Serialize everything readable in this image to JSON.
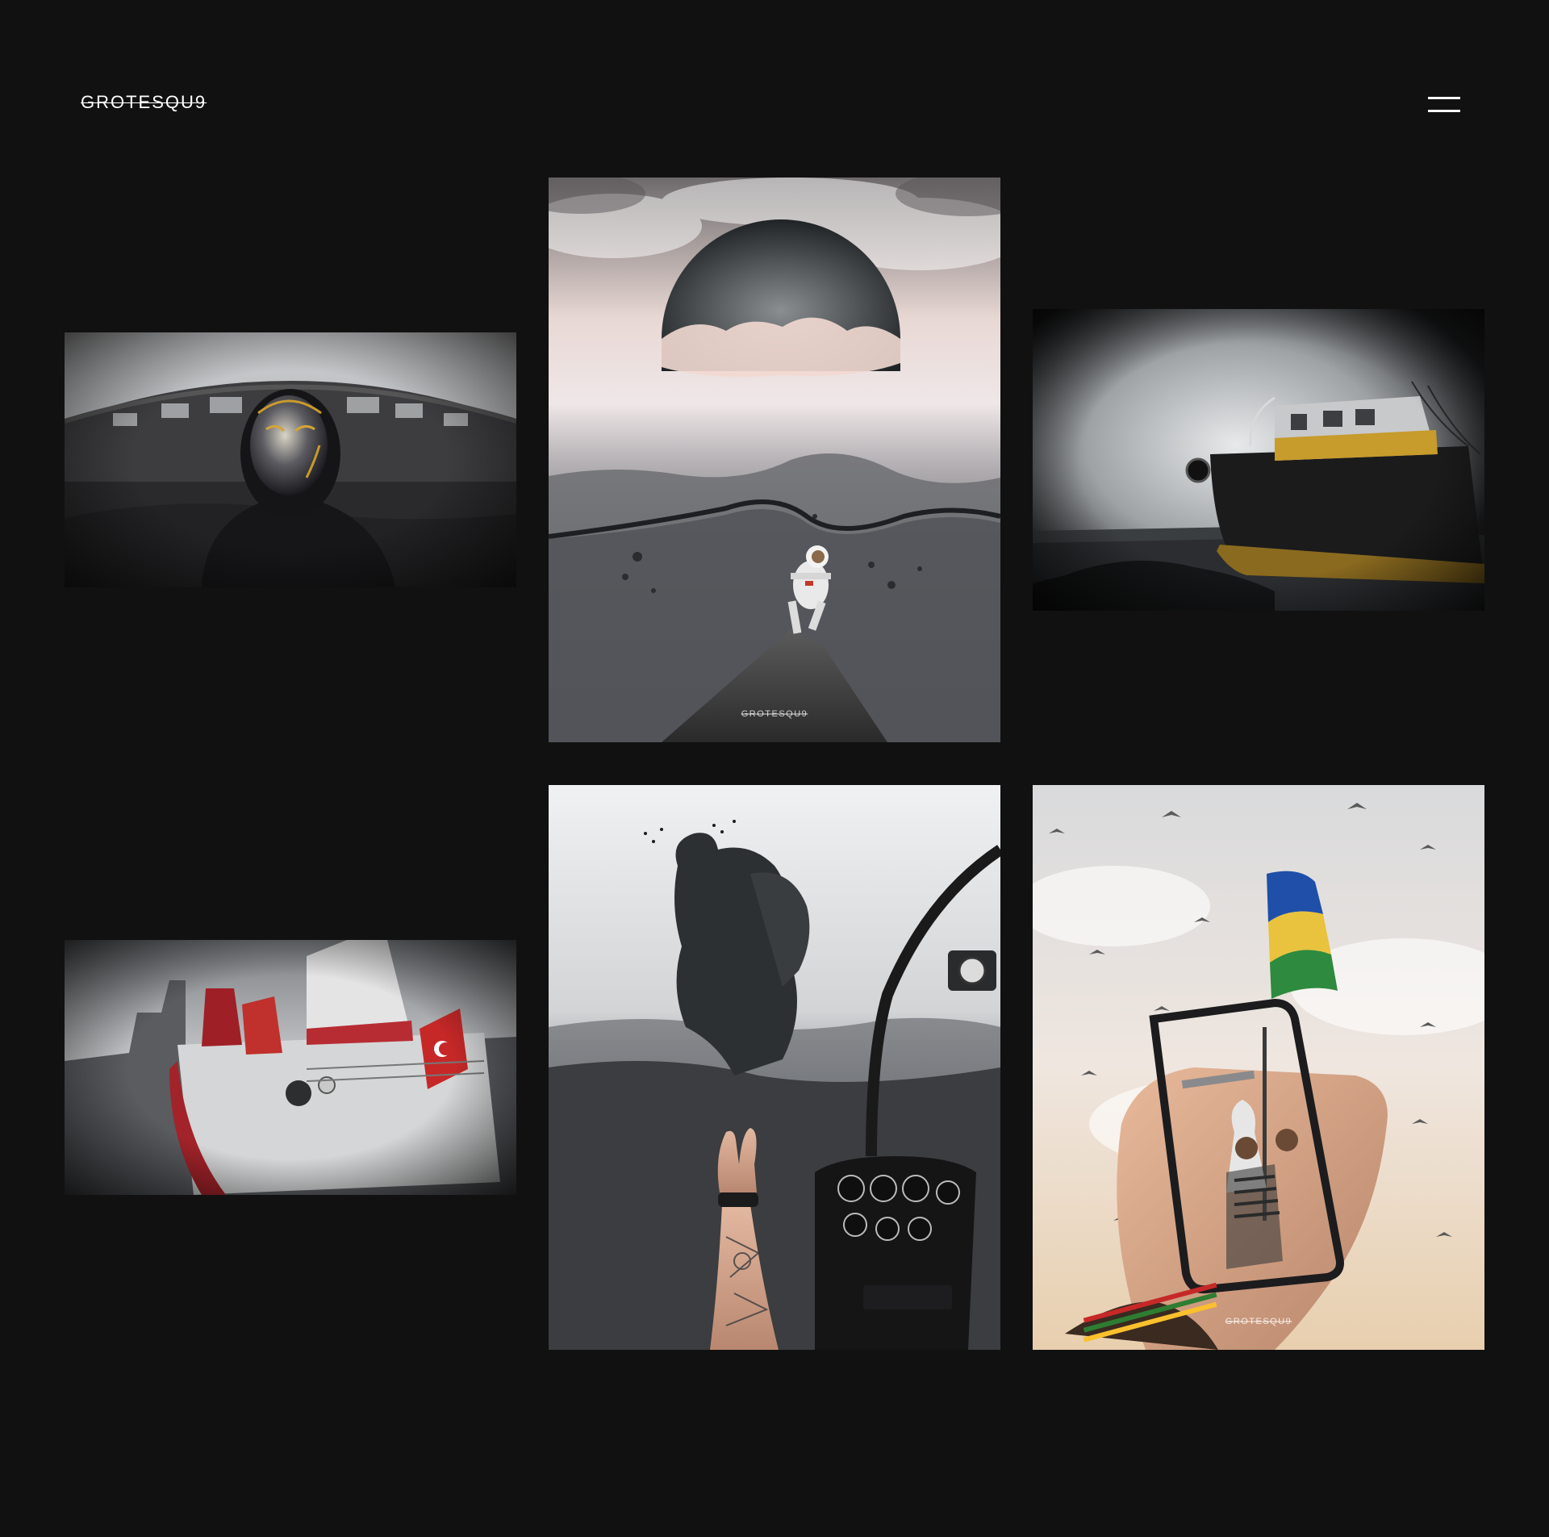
{
  "header": {
    "logo_text": "GROTESQU9",
    "menu_icon": "hamburger-menu-icon"
  },
  "gallery": {
    "items": [
      {
        "subject": "masked-figure-photo",
        "watermark": ""
      },
      {
        "subject": "astronaut-underwater-artwork",
        "watermark": "GROTESQU9"
      },
      {
        "subject": "abandoned-boat-photo",
        "watermark": ""
      },
      {
        "subject": "red-white-ship-photo",
        "watermark": ""
      },
      {
        "subject": "helicopter-giant-artwork",
        "watermark": ""
      },
      {
        "subject": "phone-flag-artwork",
        "watermark": "GROTESQU9"
      }
    ]
  },
  "colors": {
    "background": "#111111",
    "text": "#ffffff"
  }
}
